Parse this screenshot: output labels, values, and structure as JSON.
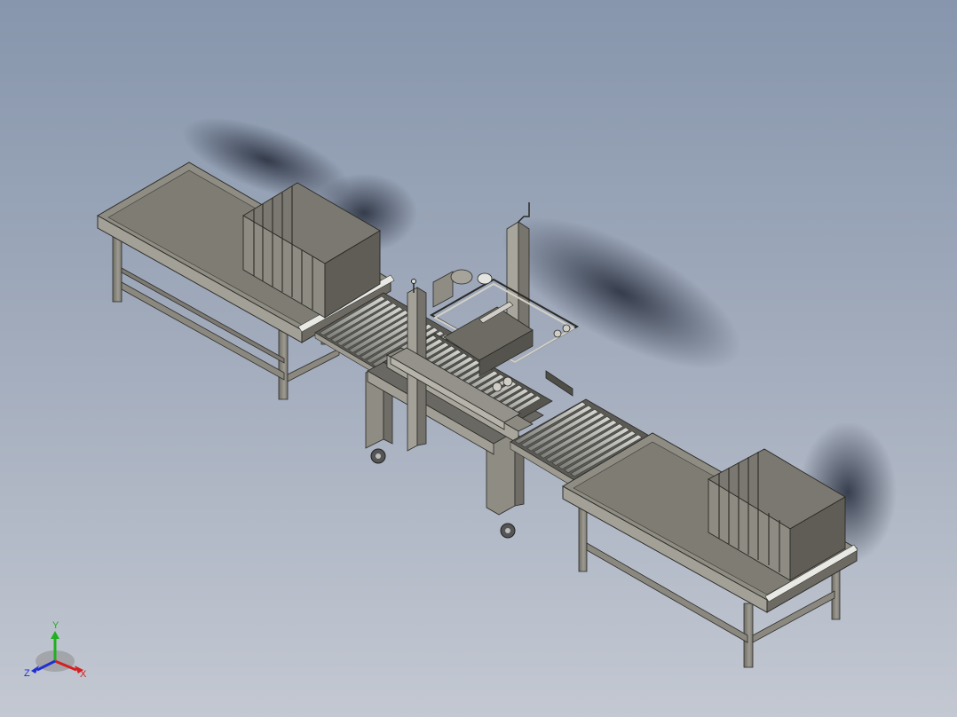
{
  "app": {
    "view": "isometric",
    "background_top": "#8796ad",
    "background_bottom": "#c3c8d2"
  },
  "model": {
    "components": [
      {
        "name": "infeed-table",
        "icon": "table-icon"
      },
      {
        "name": "carton-stack-infeed",
        "icon": "box-icon",
        "count": 7
      },
      {
        "name": "roller-conveyor-infeed",
        "icon": "roller-icon"
      },
      {
        "name": "case-sealer",
        "icon": "machine-icon"
      },
      {
        "name": "roller-conveyor-outfeed",
        "icon": "roller-icon"
      },
      {
        "name": "outfeed-table",
        "icon": "table-icon"
      },
      {
        "name": "carton-stack-outfeed",
        "icon": "box-icon",
        "count": 7
      }
    ]
  },
  "triad": {
    "x_label": "X",
    "y_label": "Y",
    "z_label": "Z",
    "x_color": "#d42020",
    "y_color": "#20b020",
    "z_color": "#2030d0"
  }
}
